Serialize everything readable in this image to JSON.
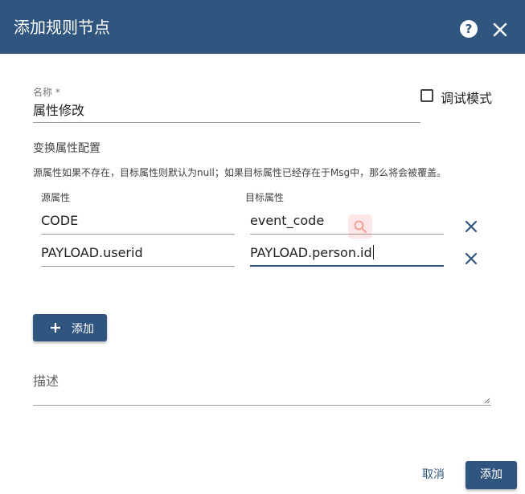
{
  "dialog": {
    "title": "添加规则节点",
    "help_icon": "?",
    "close_icon": "close"
  },
  "form": {
    "name_label": "名称 *",
    "name_value": "属性修改",
    "debug_label": "调试模式",
    "debug_checked": false,
    "section_title": "变换属性配置",
    "hint": "源属性如果不存在，目标属性则默认为null；如果目标属性已经存在于Msg中，那么将会被覆盖。",
    "columns": {
      "source": "源属性",
      "target": "目标属性"
    },
    "mappings": [
      {
        "source": "CODE",
        "target": "event_code"
      },
      {
        "source": "PAYLOAD.userid",
        "target": "PAYLOAD.person.id"
      }
    ],
    "add_label": "添加",
    "description_label": "描述"
  },
  "footer": {
    "cancel_label": "取消",
    "confirm_label": "添加"
  },
  "colors": {
    "primary": "#305680",
    "watermark": "#f44336"
  }
}
